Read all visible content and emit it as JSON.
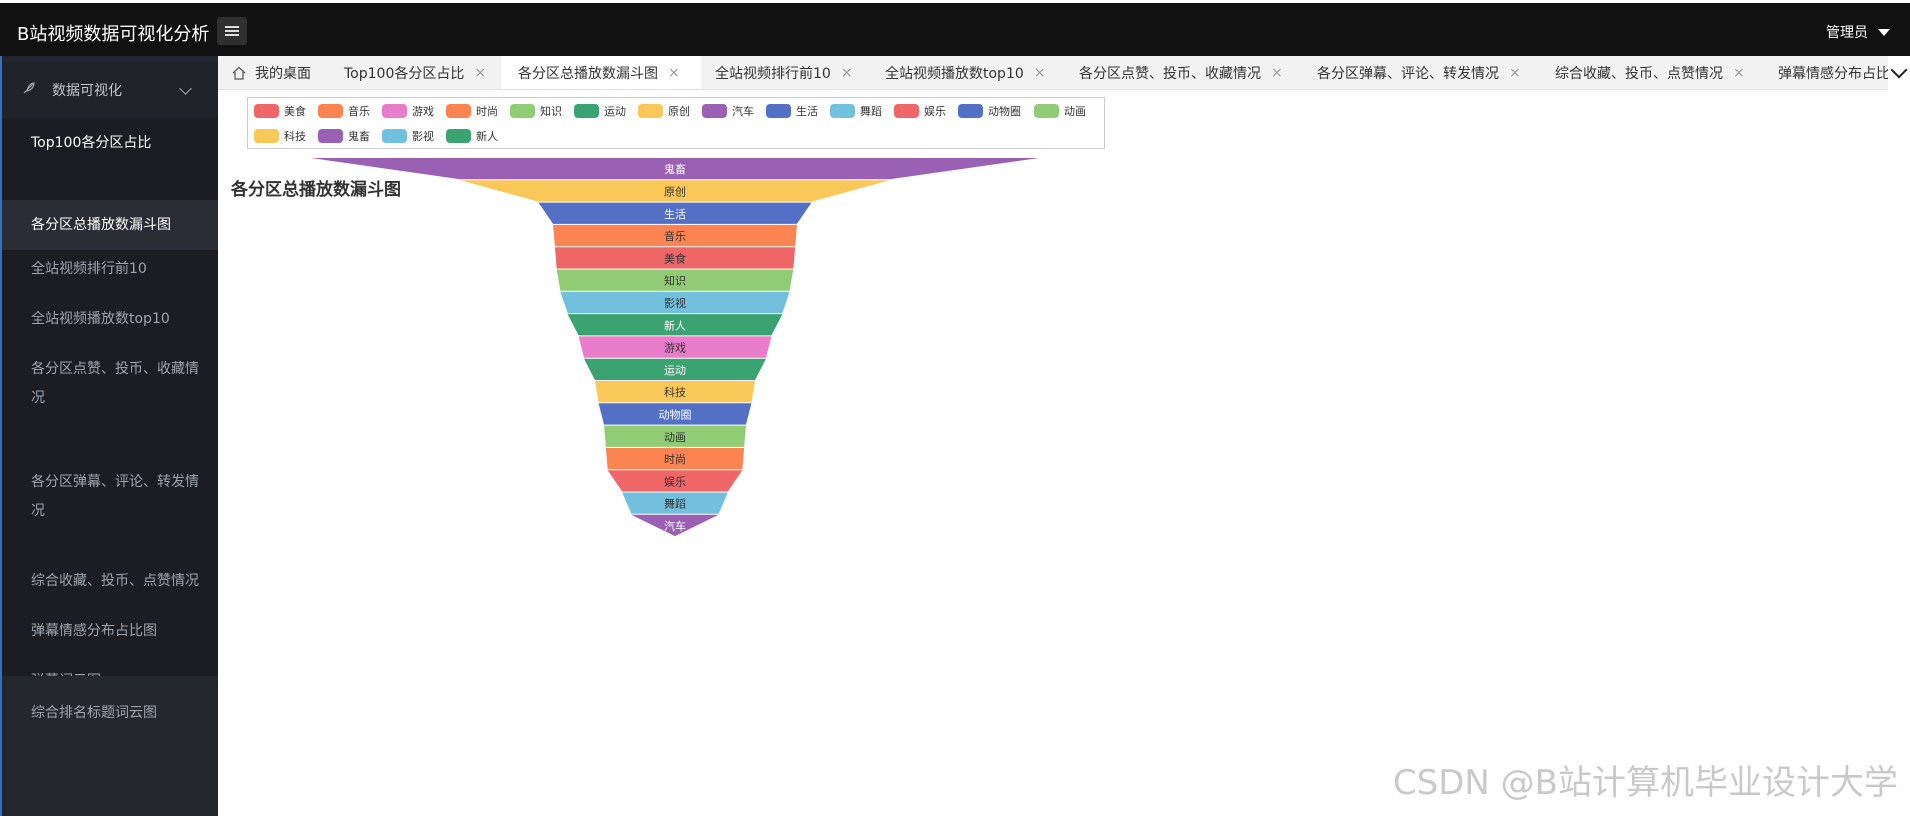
{
  "app": {
    "title": "B站视频数据可视化分析",
    "user": "管理员"
  },
  "icons": {
    "menu": "hamburger-icon",
    "home": "home-icon",
    "feather": "feather-icon",
    "close": "close-icon",
    "chevron": "chevron-down-icon"
  },
  "sidebar": {
    "group": "数据可视化",
    "items": [
      {
        "label": "Top100各分区占比"
      },
      {
        "label": "各分区总播放数漏斗图"
      },
      {
        "label": "全站视频排行前10"
      },
      {
        "label": "全站视频播放数top10"
      },
      {
        "label": "各分区点赞、投币、收藏情况"
      },
      {
        "label": "各分区弹幕、评论、转发情况"
      },
      {
        "label": "综合收藏、投币、点赞情况"
      },
      {
        "label": "弹幕情感分布占比图"
      },
      {
        "label": "弹幕词云图"
      },
      {
        "label": "综合排名标题词云图"
      }
    ]
  },
  "tabs": [
    {
      "label": "我的桌面"
    },
    {
      "label": "Top100各分区占比",
      "close": "×"
    },
    {
      "label": "各分区总播放数漏斗图",
      "close": "×"
    },
    {
      "label": "全站视频排行前10",
      "close": "×"
    },
    {
      "label": "全站视频播放数top10",
      "close": "×"
    },
    {
      "label": "各分区点赞、投币、收藏情况",
      "close": "×"
    },
    {
      "label": "各分区弹幕、评论、转发情况",
      "close": "×"
    },
    {
      "label": "综合收藏、投币、点赞情况",
      "close": "×"
    },
    {
      "label": "弹幕情感分布占比图"
    }
  ],
  "chart_data": {
    "type": "funnel",
    "title": "各分区总播放数漏斗图",
    "legend": [
      "美食",
      "音乐",
      "游戏",
      "时尚",
      "知识",
      "运动",
      "原创",
      "汽车",
      "生活",
      "舞蹈",
      "娱乐",
      "动物圈",
      "动画",
      "科技",
      "鬼畜",
      "影视",
      "新人"
    ],
    "legend_colors": [
      "#ee6666",
      "#fc8452",
      "#ea7ccc",
      "#fc8452",
      "#91cc75",
      "#3ba272",
      "#fac858",
      "#9a60b4",
      "#5470c6",
      "#73c0de",
      "#ee6666",
      "#5470c6",
      "#91cc75",
      "#fac858",
      "#9a60b4",
      "#73c0de",
      "#3ba272"
    ],
    "segments": [
      {
        "name": "鬼畜",
        "width_pct": 100,
        "color": "#9a60b4",
        "label_color": "#ffffff"
      },
      {
        "name": "原创",
        "width_pct": 59,
        "color": "#fac858",
        "label_color": "#333333"
      },
      {
        "name": "生活",
        "width_pct": 37.5,
        "color": "#5470c6",
        "label_color": "#ffffff"
      },
      {
        "name": "音乐",
        "width_pct": 33.5,
        "color": "#fc8452",
        "label_color": "#333333"
      },
      {
        "name": "美食",
        "width_pct": 33,
        "color": "#ee6666",
        "label_color": "#333333"
      },
      {
        "name": "知识",
        "width_pct": 32.5,
        "color": "#91cc75",
        "label_color": "#333333"
      },
      {
        "name": "影视",
        "width_pct": 31.5,
        "color": "#73c0de",
        "label_color": "#333333"
      },
      {
        "name": "新人",
        "width_pct": 29.5,
        "color": "#3ba272",
        "label_color": "#ffffff"
      },
      {
        "name": "游戏",
        "width_pct": 26.5,
        "color": "#ea7ccc",
        "label_color": "#333333"
      },
      {
        "name": "运动",
        "width_pct": 25,
        "color": "#3ba272",
        "label_color": "#ffffff"
      },
      {
        "name": "科技",
        "width_pct": 22,
        "color": "#fac858",
        "label_color": "#333333"
      },
      {
        "name": "动物圈",
        "width_pct": 21,
        "color": "#5470c6",
        "label_color": "#ffffff"
      },
      {
        "name": "动画",
        "width_pct": 19.5,
        "color": "#91cc75",
        "label_color": "#333333"
      },
      {
        "name": "时尚",
        "width_pct": 19,
        "color": "#fc8452",
        "label_color": "#333333"
      },
      {
        "name": "娱乐",
        "width_pct": 18.5,
        "color": "#ee6666",
        "label_color": "#333333"
      },
      {
        "name": "舞蹈",
        "width_pct": 14.5,
        "color": "#73c0de",
        "label_color": "#333333"
      },
      {
        "name": "汽车",
        "width_pct": 12,
        "color": "#9a60b4",
        "label_color": "#ffffff"
      }
    ]
  },
  "watermark": "CSDN @B站计算机毕业设计大学"
}
